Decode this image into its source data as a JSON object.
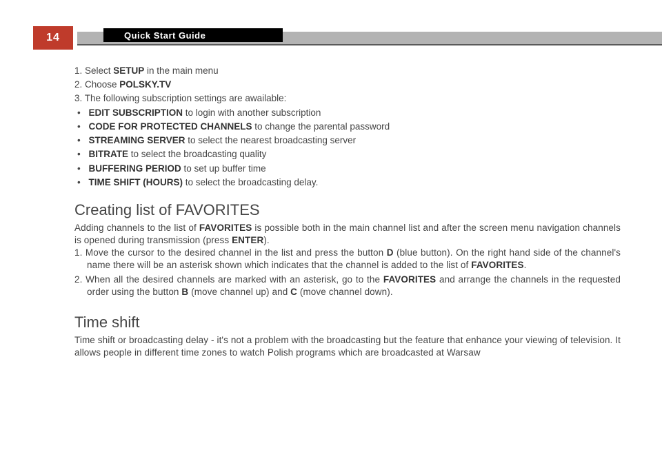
{
  "page_number": "14",
  "header_title": "Quick Start Guide",
  "steps": {
    "s1_pre": "1. Select ",
    "s1_b": "SETUP",
    "s1_post": " in the main menu",
    "s2_pre": "2. Choose ",
    "s2_b": "POLSKY.TV",
    "s3": "3. The following subscription settings are awailable:"
  },
  "bullets": {
    "b1_b": "EDIT SUBSCRIPTION",
    "b1_post": " to login with another subscription",
    "b2_b": "CODE FOR PROTECTED CHANNELS",
    "b2_post": " to change the parental password",
    "b3_b": "STREAMING SERVER",
    "b3_post": " to select the nearest broadcasting server",
    "b4_b": "BITRATE",
    "b4_post": " to select the broadcasting quality",
    "b5_b": "BUFFERING PERIOD",
    "b5_post": " to set up buffer time",
    "b6_b": "TIME SHIFT (HOURS)",
    "b6_post": " to select the broadcasting delay."
  },
  "fav": {
    "heading": "Creating list of FAVORITES",
    "intro_a": "Adding channels to the list of ",
    "intro_b": "FAVORITES",
    "intro_c": " is possible both in the main channel list and after the screen menu navigation channels is opened during transmission (press ",
    "intro_d": "ENTER",
    "intro_e": ").",
    "i1_a": "1. Move the cursor to the desired channel in the list and press the button ",
    "i1_b": "D",
    "i1_c": " (blue button). On the right hand side of the channel's name there will be an asterisk shown which indicates that the channel is added to the list of  ",
    "i1_d": "FAVORITES",
    "i1_e": ".",
    "i2_a": "2. When all the desired channels are marked with an asterisk, go to the ",
    "i2_b": "FAVORITES",
    "i2_c": " and arrange the channels in the requested order using the button ",
    "i2_d": "B",
    "i2_e": " (move channel up) and ",
    "i2_f": "C",
    "i2_g": " (move channel down)."
  },
  "ts": {
    "heading": "Time shift",
    "body": "Time shift or broadcasting delay - it's not a problem with the broadcasting but the feature that enhance your viewing of television. It allows people in different time zones to watch Polish programs which are broadcasted at Warsaw"
  }
}
